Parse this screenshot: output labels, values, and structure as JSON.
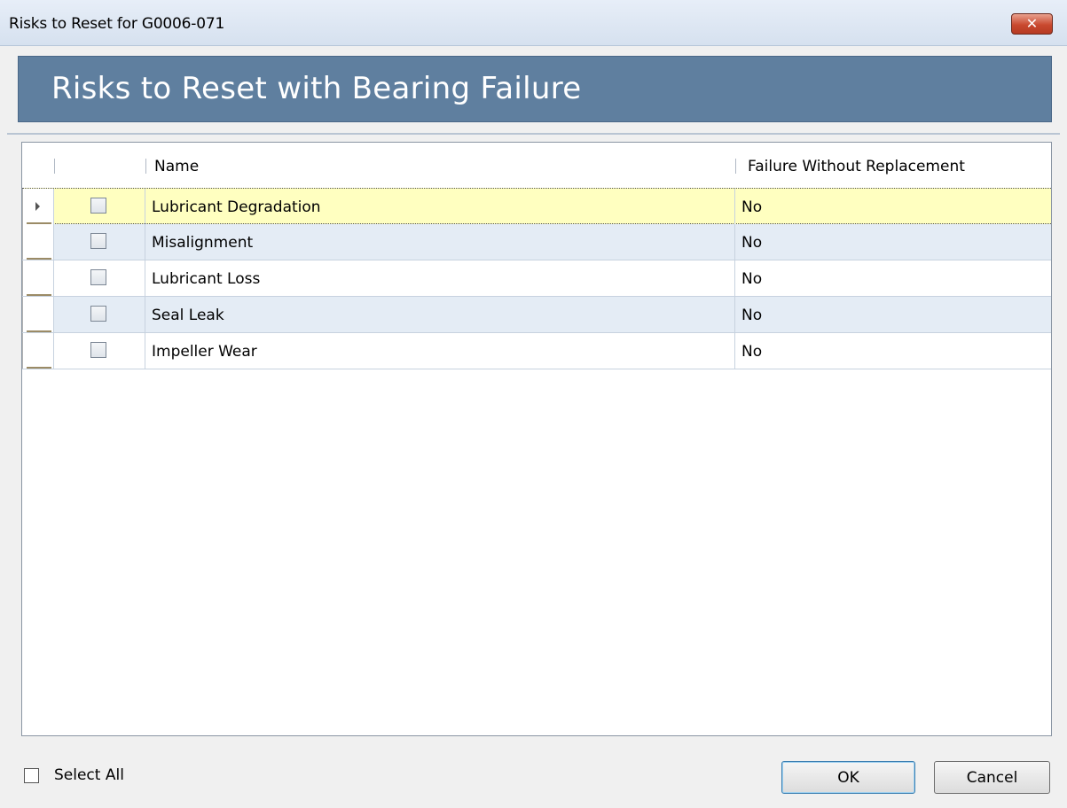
{
  "window": {
    "title": "Risks to Reset for G0006-071",
    "close_glyph": "✕"
  },
  "banner": {
    "heading": "Risks to Reset with Bearing Failure"
  },
  "grid": {
    "columns": [
      "",
      "Name",
      "Failure Without Replacement"
    ],
    "rows": [
      {
        "name": "Lubricant Degradation",
        "value": "No",
        "checked": false,
        "selected": true
      },
      {
        "name": "Misalignment",
        "value": "No",
        "checked": false,
        "selected": false
      },
      {
        "name": "Lubricant Loss",
        "value": "No",
        "checked": false,
        "selected": false
      },
      {
        "name": "Seal Leak",
        "value": "No",
        "checked": false,
        "selected": false
      },
      {
        "name": "Impeller Wear",
        "value": "No",
        "checked": false,
        "selected": false
      }
    ]
  },
  "footer": {
    "select_all_label": "Select All",
    "select_all_checked": false,
    "ok_label": "OK",
    "cancel_label": "Cancel"
  }
}
